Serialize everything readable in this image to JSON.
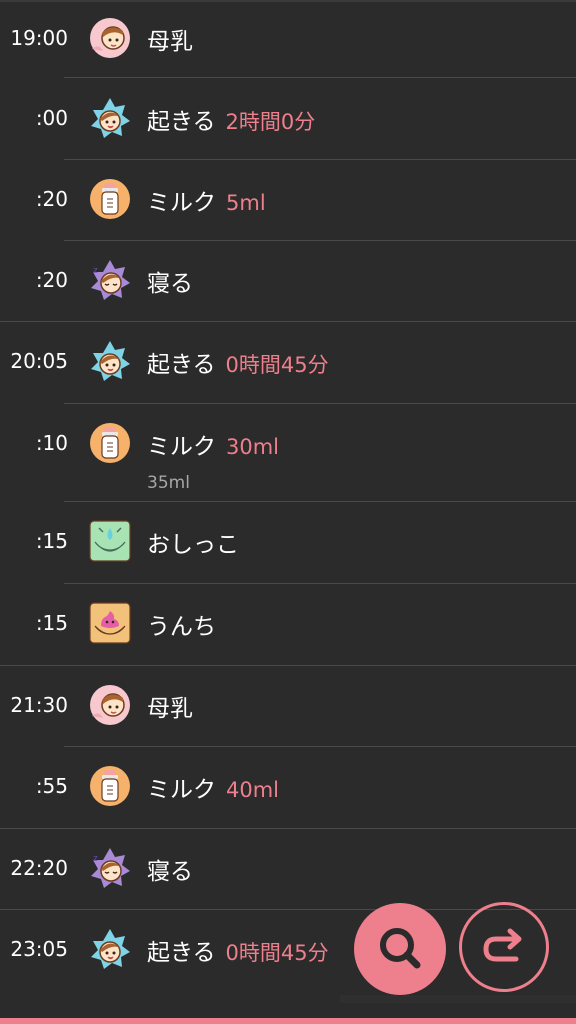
{
  "colors": {
    "background": "#2b2b2b",
    "accent": "#ee7f8c",
    "text": "#ffffff",
    "subtext": "#a7a7a7",
    "divider": "#4a4a4a"
  },
  "entries": [
    {
      "time": "19:00",
      "icon": "breastfeeding-icon",
      "label": "母乳",
      "detail": "",
      "note": ""
    },
    {
      "time": ":00",
      "icon": "wake-up-icon",
      "label": "起きる",
      "detail": "2時間0分",
      "note": ""
    },
    {
      "time": ":20",
      "icon": "milk-bottle-icon",
      "label": "ミルク",
      "detail": "5ml",
      "note": ""
    },
    {
      "time": ":20",
      "icon": "sleep-icon",
      "label": "寝る",
      "detail": "",
      "note": ""
    },
    {
      "time": "20:05",
      "icon": "wake-up-icon",
      "label": "起きる",
      "detail": "0時間45分",
      "note": ""
    },
    {
      "time": ":10",
      "icon": "milk-bottle-icon",
      "label": "ミルク",
      "detail": "30ml",
      "note": "35ml"
    },
    {
      "time": ":15",
      "icon": "pee-icon",
      "label": "おしっこ",
      "detail": "",
      "note": ""
    },
    {
      "time": ":15",
      "icon": "poop-icon",
      "label": "うんち",
      "detail": "",
      "note": ""
    },
    {
      "time": "21:30",
      "icon": "breastfeeding-icon",
      "label": "母乳",
      "detail": "",
      "note": ""
    },
    {
      "time": ":55",
      "icon": "milk-bottle-icon",
      "label": "ミルク",
      "detail": "40ml",
      "note": ""
    },
    {
      "time": "22:20",
      "icon": "sleep-icon",
      "label": "寝る",
      "detail": "",
      "note": ""
    },
    {
      "time": "23:05",
      "icon": "wake-up-icon",
      "label": "起きる",
      "detail": "0時間45分",
      "note": ""
    }
  ],
  "actions": {
    "search_icon": "search-icon",
    "redo_icon": "redo-icon"
  }
}
